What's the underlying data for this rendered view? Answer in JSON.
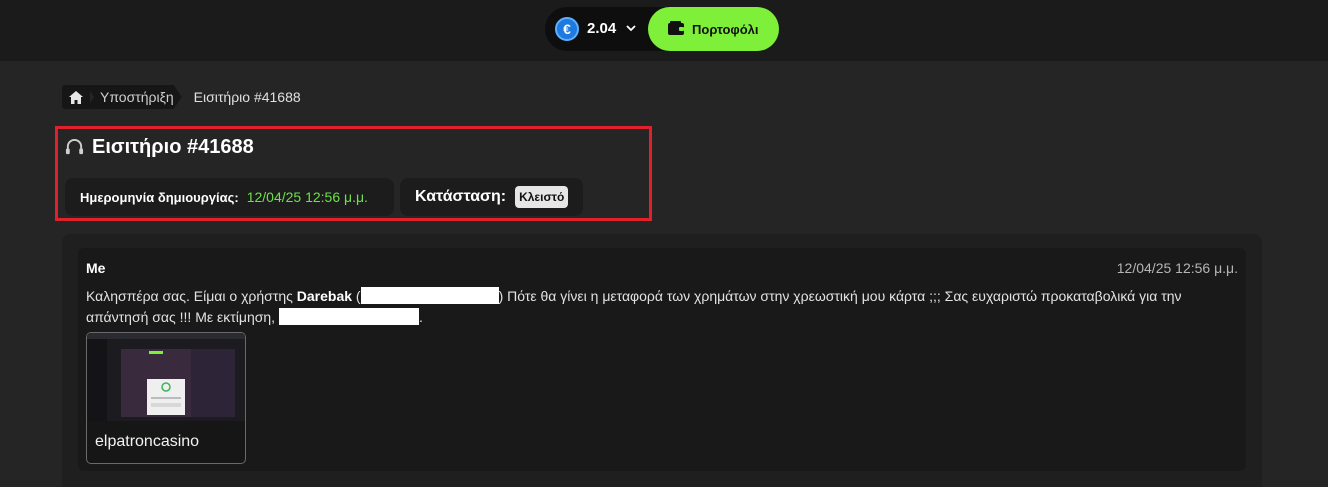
{
  "topbar": {
    "currency_symbol": "€",
    "balance": "2.04",
    "wallet_label": "Πορτοφόλι",
    "accent": "#7ef03a"
  },
  "breadcrumb": {
    "home_icon": "home-icon",
    "items": [
      "Υποστήριξη"
    ],
    "current": "Εισιτήριο #41688"
  },
  "ticket": {
    "icon": "headset-icon",
    "title": "Εισιτήριο #41688",
    "created_label": "Ημερομηνία δημιουργίας:",
    "created_value": "12/04/25 12:56 μ.μ.",
    "status_label": "Κατάσταση:",
    "status_value": "Κλειστό",
    "highlight_color": "#e0202a"
  },
  "message": {
    "author": "Me",
    "time": "12/04/25 12:56 μ.μ.",
    "text_1": "Καλησπέρα σας. Είμαι ο χρήστης ",
    "username": "Darebak",
    "text_2": " (",
    "text_3": ") Πότε θα γίνει η μεταφορά των χρημάτων στην χρεωστική μου κάρτα ;;; Σας ευχαριστώ προκαταβολικά για την απάντησή σας !!! Με εκτίμηση, ",
    "text_4": ".",
    "attachment_name": "elpatroncasino"
  }
}
